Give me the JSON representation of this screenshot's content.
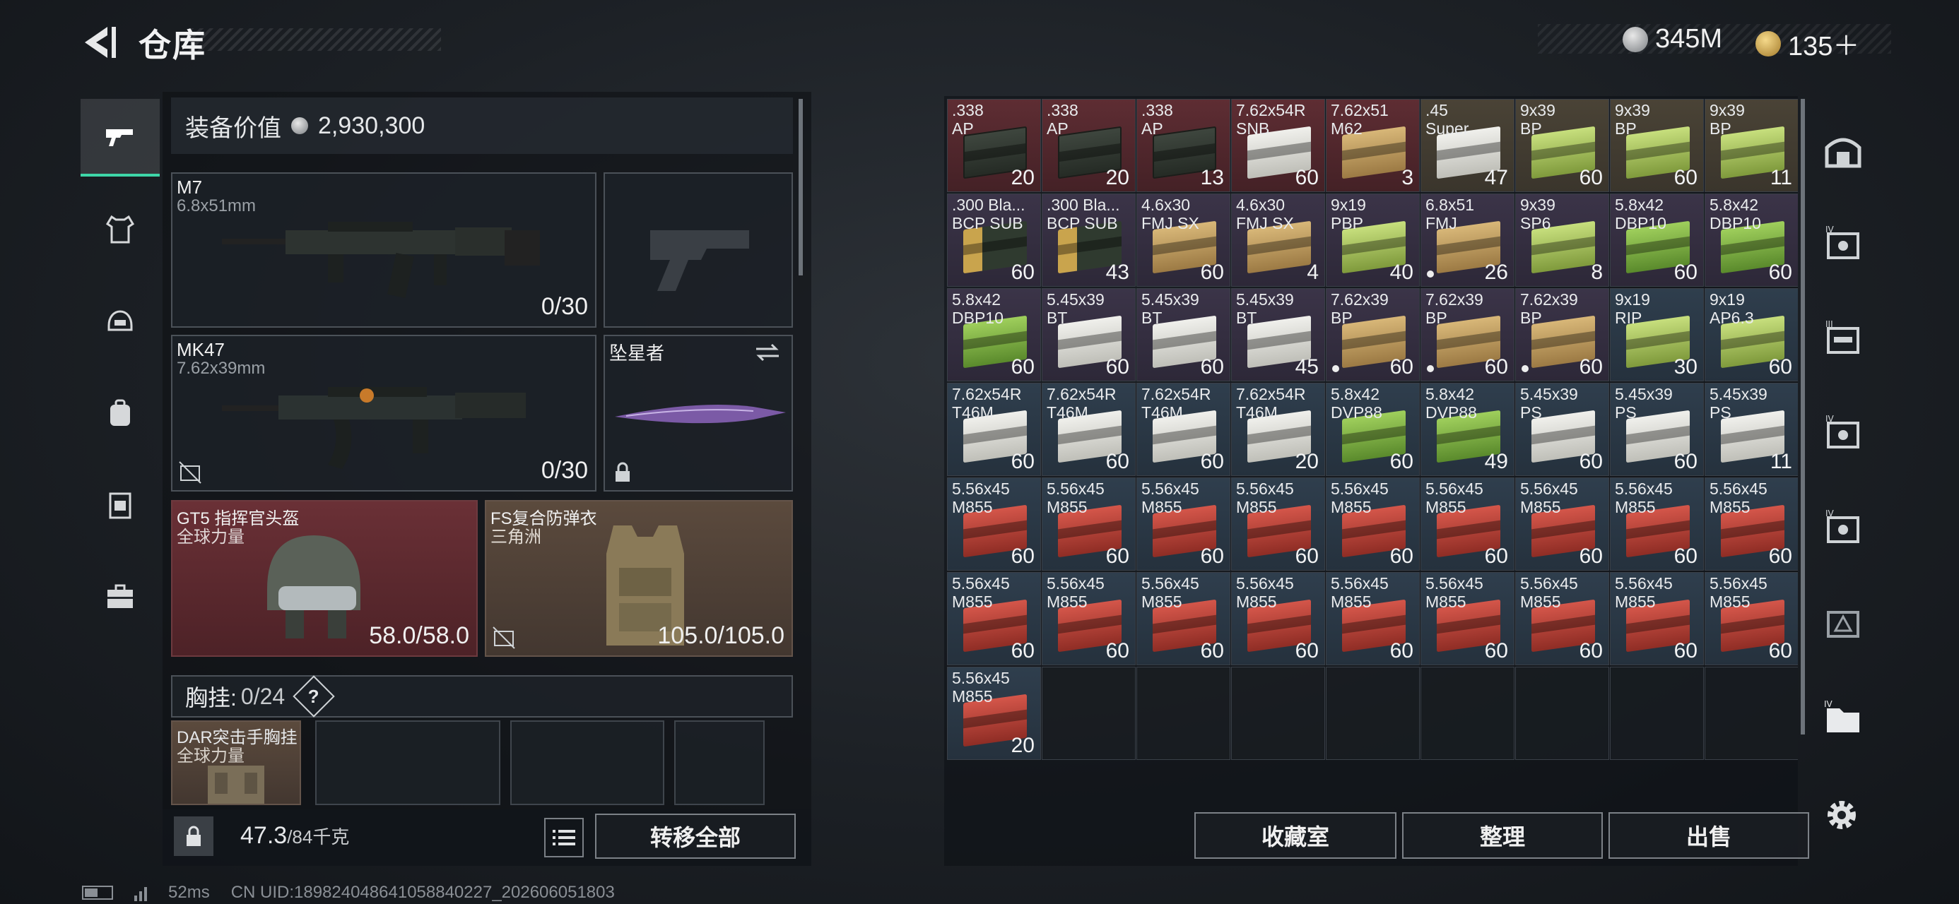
{
  "header": {
    "title": "仓库",
    "currency_1": "345M",
    "currency_2": "135＋"
  },
  "loadout": {
    "equip_value_label": "装备价值",
    "equip_value": "2,930,300",
    "primary": {
      "name": "M7",
      "caliber": "6.8x51mm",
      "ammo": "0/30"
    },
    "secondary": {
      "name": "MK47",
      "caliber": "7.62x39mm",
      "ammo": "0/30"
    },
    "melee": {
      "name": "坠星者"
    },
    "helmet": {
      "name": "GT5 指挥官头盔",
      "sub": "全球力量",
      "durability": "58.0/58.0"
    },
    "armor": {
      "name": "FS复合防弹衣",
      "sub": "三角洲",
      "durability": "105.0/105.0"
    },
    "rig": {
      "label": "胸挂:",
      "count": "0/24",
      "help": "?"
    },
    "rig_item": {
      "name": "DAR突击手胸挂",
      "sub": "全球力量"
    },
    "weight": "47.3",
    "weight_max": "/84千克",
    "transfer_all": "转移全部"
  },
  "stash": {
    "items": [
      {
        "name": ".338\nAP",
        "qty": "20",
        "bg": "red",
        "box": "ammo-dark",
        "dot": false
      },
      {
        "name": ".338\nAP",
        "qty": "20",
        "bg": "red",
        "box": "ammo-dark",
        "dot": false
      },
      {
        "name": ".338\nAP",
        "qty": "13",
        "bg": "red",
        "box": "ammo-dark",
        "dot": false
      },
      {
        "name": "7.62x54R\nSNB",
        "qty": "60",
        "bg": "red",
        "box": "ammo-white",
        "dot": false
      },
      {
        "name": "7.62x51\nM62",
        "qty": "3",
        "bg": "red",
        "box": "ammo-tan",
        "dot": false
      },
      {
        "name": ".45\nSuper",
        "qty": "47",
        "bg": "tan",
        "box": "ammo-white",
        "dot": false
      },
      {
        "name": "9x39\nBP",
        "qty": "60",
        "bg": "tan",
        "box": "ammo-green",
        "dot": false
      },
      {
        "name": "9x39\nBP",
        "qty": "60",
        "bg": "tan",
        "box": "ammo-green",
        "dot": false
      },
      {
        "name": "9x39\nBP",
        "qty": "11",
        "bg": "tan",
        "box": "ammo-green",
        "dot": false
      },
      {
        "name": ".300 Bla...\nBCP SUB",
        "qty": "60",
        "bg": "purple",
        "box": "ammo-bullet",
        "dot": false
      },
      {
        "name": ".300 Bla...\nBCP SUB",
        "qty": "43",
        "bg": "purple",
        "box": "ammo-bullet",
        "dot": false
      },
      {
        "name": "4.6x30\nFMJ SX",
        "qty": "60",
        "bg": "purple",
        "box": "ammo-tan",
        "dot": false
      },
      {
        "name": "4.6x30\nFMJ SX",
        "qty": "4",
        "bg": "purple",
        "box": "ammo-tan",
        "dot": false
      },
      {
        "name": "9x19\nPBP",
        "qty": "40",
        "bg": "purple",
        "box": "ammo-green",
        "dot": false
      },
      {
        "name": "6.8x51\nFMJ",
        "qty": "26",
        "bg": "purple",
        "box": "ammo-tan",
        "dot": true
      },
      {
        "name": "9x39\nSP6",
        "qty": "8",
        "bg": "purple",
        "box": "ammo-green",
        "dot": false
      },
      {
        "name": "5.8x42\nDBP10",
        "qty": "60",
        "bg": "purple",
        "box": "ammo-lime",
        "dot": false
      },
      {
        "name": "5.8x42\nDBP10",
        "qty": "60",
        "bg": "purple",
        "box": "ammo-lime",
        "dot": false
      },
      {
        "name": "5.8x42\nDBP10",
        "qty": "60",
        "bg": "purple",
        "box": "ammo-lime",
        "dot": false
      },
      {
        "name": "5.45x39\nBT",
        "qty": "60",
        "bg": "purple",
        "box": "ammo-white",
        "dot": false
      },
      {
        "name": "5.45x39\nBT",
        "qty": "60",
        "bg": "purple",
        "box": "ammo-white",
        "dot": false
      },
      {
        "name": "5.45x39\nBT",
        "qty": "45",
        "bg": "purple",
        "box": "ammo-white",
        "dot": false
      },
      {
        "name": "7.62x39\nBP",
        "qty": "60",
        "bg": "purple",
        "box": "ammo-tan",
        "dot": true
      },
      {
        "name": "7.62x39\nBP",
        "qty": "60",
        "bg": "purple",
        "box": "ammo-tan",
        "dot": true
      },
      {
        "name": "7.62x39\nBP",
        "qty": "60",
        "bg": "purple",
        "box": "ammo-tan",
        "dot": true
      },
      {
        "name": "9x19\nRIP",
        "qty": "30",
        "bg": "blue",
        "box": "ammo-green",
        "dot": false
      },
      {
        "name": "9x19\nAP6.3",
        "qty": "60",
        "bg": "blue",
        "box": "ammo-green",
        "dot": false
      },
      {
        "name": "7.62x54R\nT46M",
        "qty": "60",
        "bg": "blue",
        "box": "ammo-white",
        "dot": false
      },
      {
        "name": "7.62x54R\nT46M",
        "qty": "60",
        "bg": "blue",
        "box": "ammo-white",
        "dot": false
      },
      {
        "name": "7.62x54R\nT46M",
        "qty": "60",
        "bg": "blue",
        "box": "ammo-white",
        "dot": false
      },
      {
        "name": "7.62x54R\nT46M",
        "qty": "20",
        "bg": "blue",
        "box": "ammo-white",
        "dot": false
      },
      {
        "name": "5.8x42\nDVP88",
        "qty": "60",
        "bg": "blue",
        "box": "ammo-lime",
        "dot": false
      },
      {
        "name": "5.8x42\nDVP88",
        "qty": "49",
        "bg": "blue",
        "box": "ammo-lime",
        "dot": false
      },
      {
        "name": "5.45x39\nPS",
        "qty": "60",
        "bg": "blue",
        "box": "ammo-white",
        "dot": false
      },
      {
        "name": "5.45x39\nPS",
        "qty": "60",
        "bg": "blue",
        "box": "ammo-white",
        "dot": false
      },
      {
        "name": "5.45x39\nPS",
        "qty": "11",
        "bg": "blue",
        "box": "ammo-white",
        "dot": false
      },
      {
        "name": "5.56x45\nM855",
        "qty": "60",
        "bg": "blue",
        "box": "ammo-red",
        "dot": false
      },
      {
        "name": "5.56x45\nM855",
        "qty": "60",
        "bg": "blue",
        "box": "ammo-red",
        "dot": false
      },
      {
        "name": "5.56x45\nM855",
        "qty": "60",
        "bg": "blue",
        "box": "ammo-red",
        "dot": false
      },
      {
        "name": "5.56x45\nM855",
        "qty": "60",
        "bg": "blue",
        "box": "ammo-red",
        "dot": false
      },
      {
        "name": "5.56x45\nM855",
        "qty": "60",
        "bg": "blue",
        "box": "ammo-red",
        "dot": false
      },
      {
        "name": "5.56x45\nM855",
        "qty": "60",
        "bg": "blue",
        "box": "ammo-red",
        "dot": false
      },
      {
        "name": "5.56x45\nM855",
        "qty": "60",
        "bg": "blue",
        "box": "ammo-red",
        "dot": false
      },
      {
        "name": "5.56x45\nM855",
        "qty": "60",
        "bg": "blue",
        "box": "ammo-red",
        "dot": false
      },
      {
        "name": "5.56x45\nM855",
        "qty": "60",
        "bg": "blue",
        "box": "ammo-red",
        "dot": false
      },
      {
        "name": "5.56x45\nM855",
        "qty": "60",
        "bg": "blue",
        "box": "ammo-red",
        "dot": false
      },
      {
        "name": "5.56x45\nM855",
        "qty": "60",
        "bg": "blue",
        "box": "ammo-red",
        "dot": false
      },
      {
        "name": "5.56x45\nM855",
        "qty": "60",
        "bg": "blue",
        "box": "ammo-red",
        "dot": false
      },
      {
        "name": "5.56x45\nM855",
        "qty": "60",
        "bg": "blue",
        "box": "ammo-red",
        "dot": false
      },
      {
        "name": "5.56x45\nM855",
        "qty": "60",
        "bg": "blue",
        "box": "ammo-red",
        "dot": false
      },
      {
        "name": "5.56x45\nM855",
        "qty": "60",
        "bg": "blue",
        "box": "ammo-red",
        "dot": false
      },
      {
        "name": "5.56x45\nM855",
        "qty": "60",
        "bg": "blue",
        "box": "ammo-red",
        "dot": false
      },
      {
        "name": "5.56x45\nM855",
        "qty": "60",
        "bg": "blue",
        "box": "ammo-red",
        "dot": false
      },
      {
        "name": "5.56x45\nM855",
        "qty": "60",
        "bg": "blue",
        "box": "ammo-red",
        "dot": false
      },
      {
        "name": "5.56x45\nM855",
        "qty": "20",
        "bg": "blue",
        "box": "ammo-red",
        "dot": false
      }
    ],
    "buttons": {
      "collection": "收藏室",
      "sort": "整理",
      "sell": "出售"
    }
  },
  "status": {
    "ping": "52ms",
    "uid": "CN UID:1898240486410588402​27_202606051803"
  },
  "colors": {
    "accent": "#3ed6a8",
    "rarity_red": "#5e2d33",
    "rarity_tan": "#4a4336",
    "rarity_purple": "#3b3448",
    "rarity_blue": "#2f3e4d"
  }
}
